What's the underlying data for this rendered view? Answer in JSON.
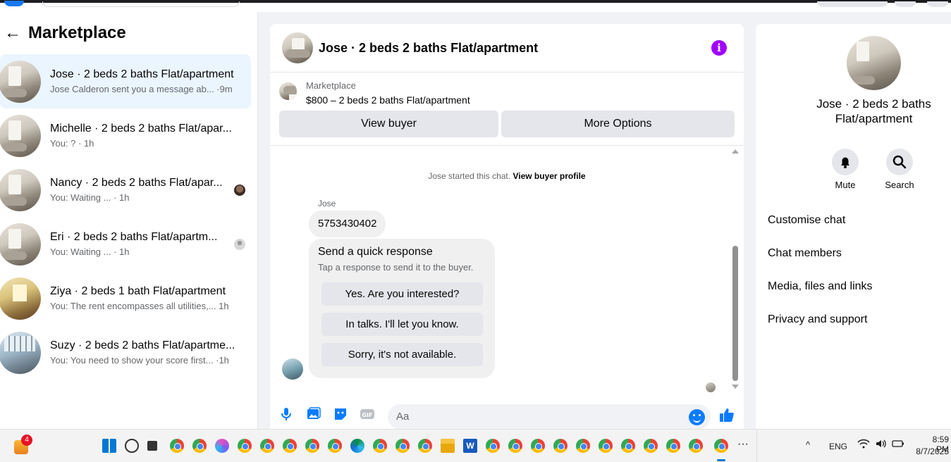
{
  "left_panel": {
    "title": "Marketplace",
    "conversations": [
      {
        "name": "Jose · 2 beds 2 baths Flat/apartment",
        "snippet": "Jose Calderon sent you a message ab... ·9m",
        "active": true
      },
      {
        "name": "Michelle · 2 beds 2 baths Flat/apar...",
        "snippet": "You: ? · 1h",
        "active": false
      },
      {
        "name": "Nancy · 2 beds 2 baths Flat/apar...",
        "snippet": "You: Waiting ... · 1h",
        "active": false
      },
      {
        "name": "Eri · 2 beds 2 baths Flat/apartm...",
        "snippet": "You: Waiting ... · 1h",
        "active": false
      },
      {
        "name": "Ziya · 2 beds 1 bath Flat/apartment",
        "snippet": "You: The rent encompasses all utilities,... 1h",
        "active": false
      },
      {
        "name": "Suzy · 2 beds 2 baths Flat/apartme...",
        "snippet": "You: You need to show your score first... ·1h",
        "active": false
      }
    ]
  },
  "chat": {
    "title": "Jose · 2 beds 2 baths Flat/apartment",
    "listing_label": "Marketplace",
    "listing_price": "$800 – 2 beds 2 baths Flat/apartment",
    "view_buyer": "View buyer",
    "more_options": "More Options",
    "system_text": "Jose started this chat.",
    "system_link": "View buyer profile",
    "sender": "Jose",
    "message": "5753430402",
    "quick_title": "Send a quick response",
    "quick_sub": "Tap a response to send it to the buyer.",
    "quick_options": [
      "Yes. Are you interested?",
      "In talks. I'll let you know.",
      "Sorry, it's not available."
    ],
    "composer_placeholder": "Aa"
  },
  "right_panel": {
    "name": "Jose · 2 beds 2 baths Flat/apartment",
    "mute": "Mute",
    "search": "Search",
    "menu": [
      "Customise chat",
      "Chat members",
      "Media, files and links",
      "Privacy and support"
    ]
  },
  "taskbar": {
    "badge": "4",
    "lang": "ENG",
    "time": "8:59 PM",
    "date": "8/7/2025"
  },
  "colors": {
    "accent": "#0a7cff",
    "info": "#a100ff",
    "active_row": "#ebf5ff"
  }
}
